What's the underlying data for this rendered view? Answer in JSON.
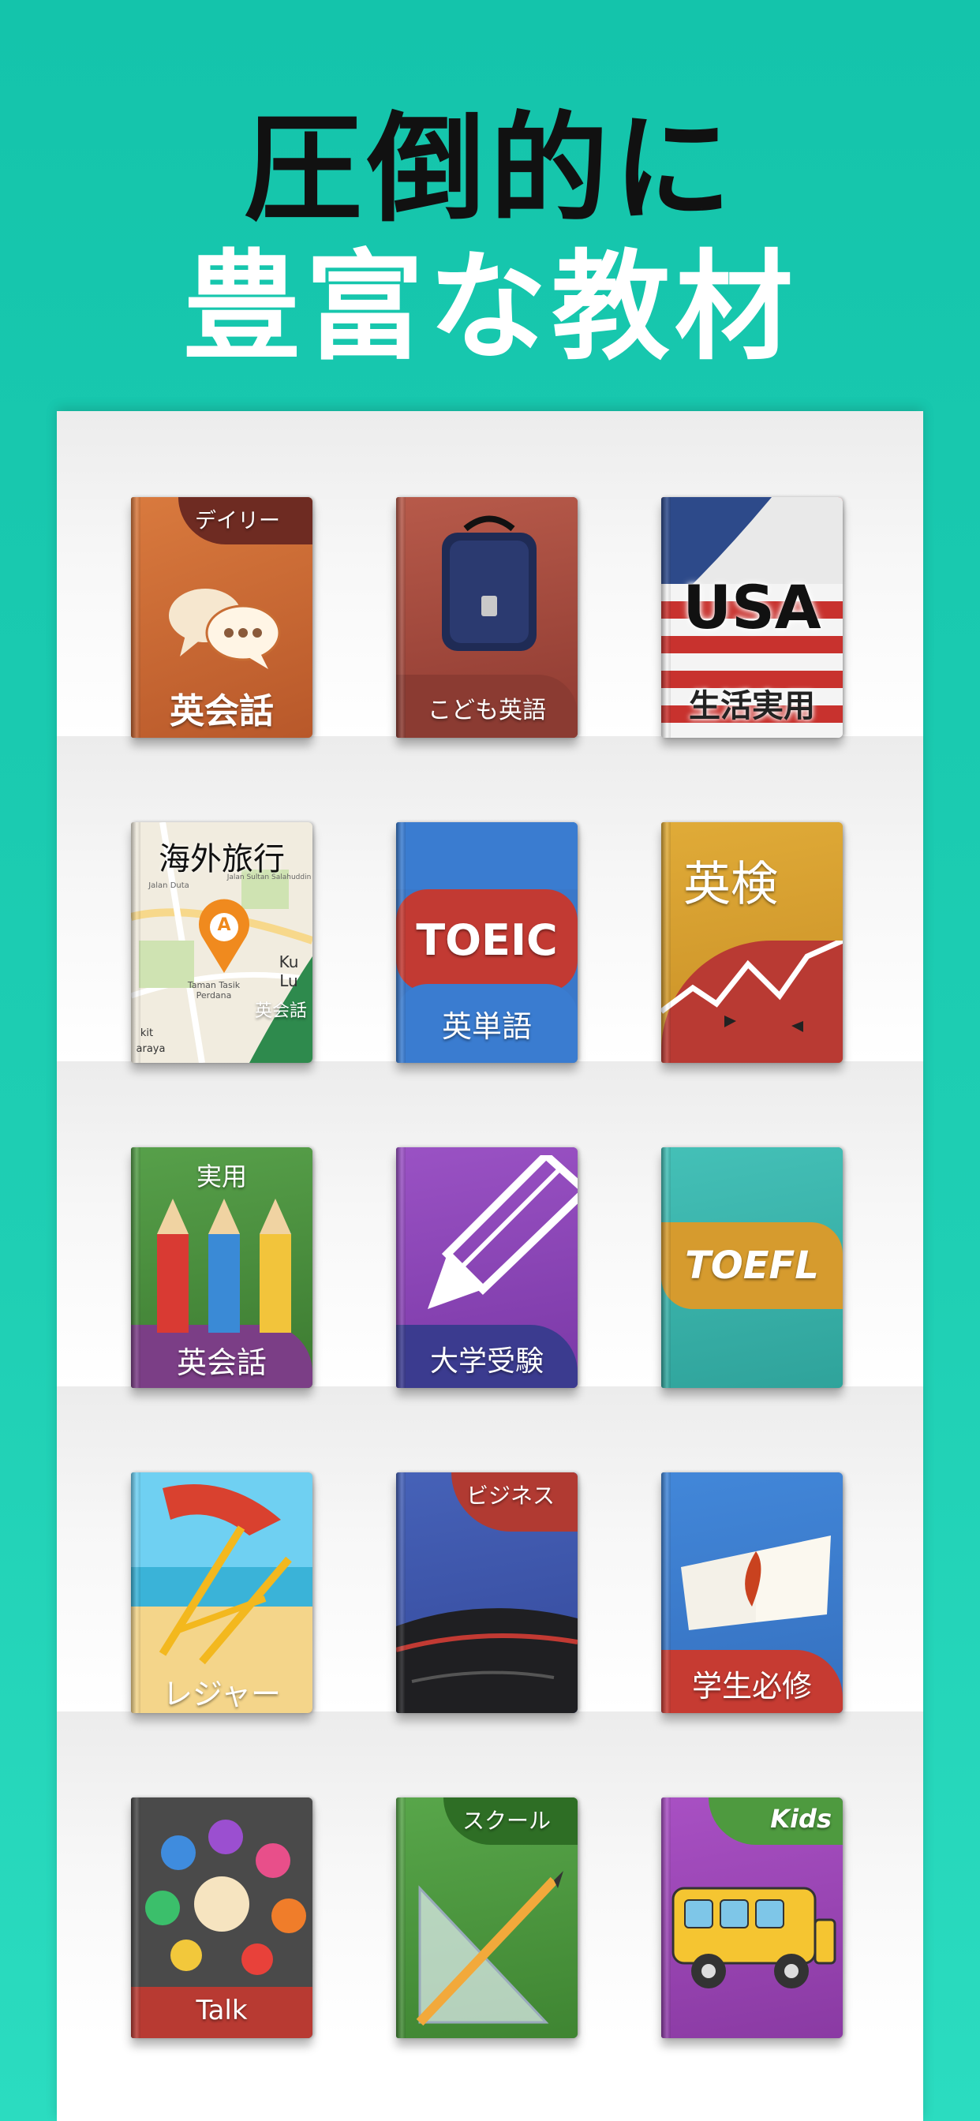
{
  "header": {
    "line1": "圧倒的に",
    "line2": "豊富な教材"
  },
  "books": [
    {
      "label": "英会話",
      "tag": "デイリー",
      "icon": "chat-bubbles-icon"
    },
    {
      "label": "こども英語",
      "icon": "school-backpack-icon"
    },
    {
      "label": "生活実用",
      "badge": "USA",
      "icon": "us-flag-icon"
    },
    {
      "label": "海外旅行",
      "corner": "英会話",
      "icon": "map-pin-icon",
      "map_texts": [
        "A",
        "Taman Tasik Perdana",
        "Ku Lu",
        "kit",
        "araya",
        "Jalan Duta",
        "Jalan Sultan Salahuddin"
      ]
    },
    {
      "label": "英単語",
      "title": "TOEIC"
    },
    {
      "label": "英検",
      "icon": "trend-chart-icon"
    },
    {
      "label": "英会話",
      "tag": "実用",
      "icon": "pencils-icon"
    },
    {
      "label": "大学受験",
      "icon": "pencil-icon"
    },
    {
      "title": "TOEFL"
    },
    {
      "label": "レジャー",
      "icon": "beach-chair-icon"
    },
    {
      "tag": "ビジネス",
      "icon": "briefcase-icon"
    },
    {
      "label": "学生必修",
      "icon": "open-book-icon"
    },
    {
      "label": "Talk",
      "icon": "colorful-spheres-icon"
    },
    {
      "tag": "スクール",
      "icon": "ruler-pencil-icon"
    },
    {
      "tag": "Kids",
      "icon": "school-bus-icon"
    }
  ]
}
